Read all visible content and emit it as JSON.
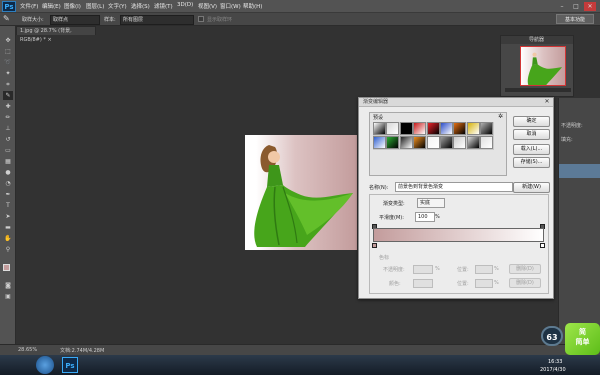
{
  "colors": {
    "accent_red": "#d23535",
    "gradient_start": "#c39c9c",
    "gradient_end": "#ffffff",
    "dress_green": "#47a51b"
  },
  "menubar": {
    "logo": "Ps",
    "items": [
      "文件(F)",
      "编辑(E)",
      "图像(I)",
      "图层(L)",
      "文字(Y)",
      "选择(S)",
      "滤镜(T)",
      "3D(D)",
      "视图(V)",
      "窗口(W)",
      "帮助(H)"
    ],
    "window_controls": [
      "–",
      "□",
      "✕"
    ]
  },
  "options": {
    "sample_size_label": "取样大小:",
    "sample_size_value": "取样点",
    "sample_label": "样本:",
    "sample_value": "所有图层",
    "show_ring_label": "显示取样环",
    "workspace": "基本功能"
  },
  "document": {
    "tab_label": "1.jpg @ 28.7% (背景, RGB/8#) *",
    "tab_close": "×"
  },
  "navigator": {
    "title": "导航器"
  },
  "right_panel": {
    "label1": "不透明度:",
    "label2": "填充:"
  },
  "statusbar": {
    "zoom": "28.65%",
    "doc_info": "文档:2.74M/4.28M"
  },
  "taskbar": {
    "clock_time": "16:33",
    "clock_date": "2017/4/30"
  },
  "gradient_editor": {
    "title": "渐变编辑器",
    "close": "✕",
    "buttons": {
      "ok": "确定",
      "cancel": "取消",
      "load": "载入(L)...",
      "save": "存储(S)...",
      "new": "新建(W)"
    },
    "presets_label": "预设",
    "gear": "✲",
    "presets": [
      "#ffffff",
      "#d8d8d8",
      "#000000",
      "#c81a1a",
      "#e8232a",
      "#2c4ec8",
      "#e46f14",
      "#d6b30c",
      "#b0b0b0",
      "#3060d0",
      "#2cae35",
      "#222222",
      "#f09020",
      "#f4f4f4",
      "#9a9a9a",
      "#cccccc",
      "#dcdcdc",
      "#e0e0e0"
    ],
    "name_label": "名称(N):",
    "name_value": "前景色到背景色渐变",
    "type_label": "渐变类型:",
    "type_value": "实底",
    "smoothness_label": "平滑度(M):",
    "smoothness_value": "100",
    "smoothness_unit": "%",
    "stops_label": "色标",
    "opacity_label": "不透明度:",
    "opacity_unit": "%",
    "location_label": "位置:",
    "location_unit": "%",
    "delete_label": "删除(D)",
    "color_label": "颜色:"
  },
  "overlays": {
    "badge": "63",
    "watermark_line1": "简",
    "watermark_line2": "简单"
  }
}
